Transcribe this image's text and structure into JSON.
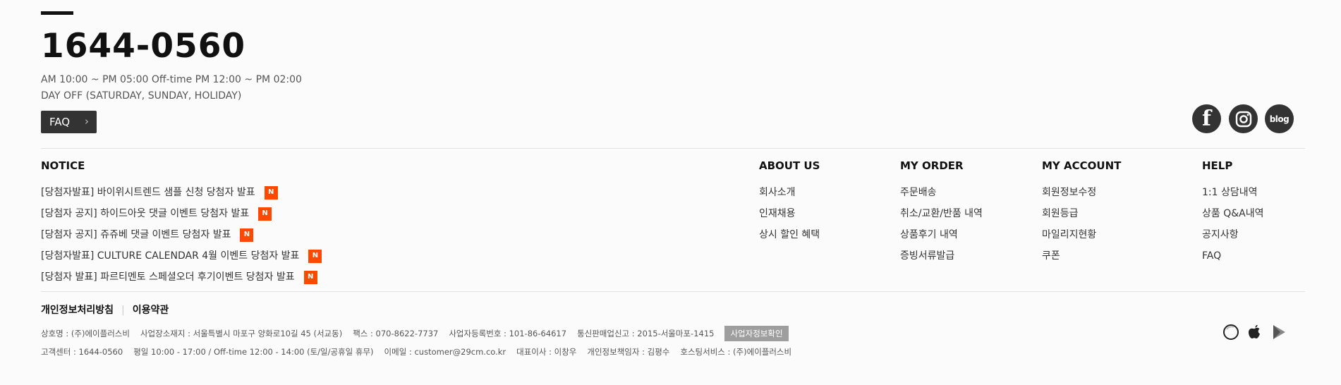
{
  "contact": {
    "phone": "1644-0560",
    "hours": "AM 10:00 ~ PM 05:00  Off-time PM 12:00 ~ PM 02:00",
    "day_off": "DAY OFF (SATURDAY, SUNDAY, HOLIDAY)",
    "faq_label": "FAQ",
    "faq_chevron": "›"
  },
  "social": {
    "facebook_glyph": "f",
    "blog_label": "blog"
  },
  "notice": {
    "title": "NOTICE",
    "badge": "N",
    "items": [
      "[당첨자발표] 바이위시트렌드 샘플 신청 당첨자 발표",
      "[당첨자 공지] 하이드아웃 댓글 이벤트 당첨자 발표",
      "[당첨자 공지] 쥬쥬베 댓글 이벤트 당첨자 발표",
      "[당첨자발표] CULTURE CALENDAR 4월 이벤트 당첨자 발표",
      "[당첨자 발표] 파르티멘토 스페셜오더 후기이벤트 당첨자 발표"
    ]
  },
  "about": {
    "title": "ABOUT US",
    "items": [
      "회사소개",
      "인재채용",
      "상시 할인 혜택"
    ]
  },
  "order": {
    "title": "MY ORDER",
    "items": [
      "주문배송",
      "취소/교환/반품 내역",
      "상품후기 내역",
      "증빙서류발급"
    ]
  },
  "account": {
    "title": "MY ACCOUNT",
    "items": [
      "회원정보수정",
      "회원등급",
      "마일리지현황",
      "쿠폰"
    ]
  },
  "help": {
    "title": "HELP",
    "items": [
      "1:1 상담내역",
      "상품 Q&A내역",
      "공지사항",
      "FAQ"
    ]
  },
  "policy": {
    "privacy": "개인정보처리방침",
    "separator": "|",
    "terms": "이용약관"
  },
  "company": {
    "line1": [
      "상호명 : (주)에이플러스비",
      "사업장소재지 : 서울특별시 마포구 양화로10길 45 (서교동)",
      "팩스 : 070-8622-7737",
      "사업자등록번호 : 101-86-64617",
      "통신판매업신고 : 2015-서울마포-1415"
    ],
    "biz_check": "사업자정보확인",
    "line2": [
      "고객센터 : 1644-0560",
      "평일 10:00 - 17:00 / Off-time 12:00 - 14:00 (토/일/공휴일 휴무)",
      "이메일 : customer@29cm.co.kr",
      "대표이사 : 이창우",
      "개인정보책임자 : 김평수",
      "호스팅서비스 : (주)에이플러스비"
    ]
  }
}
